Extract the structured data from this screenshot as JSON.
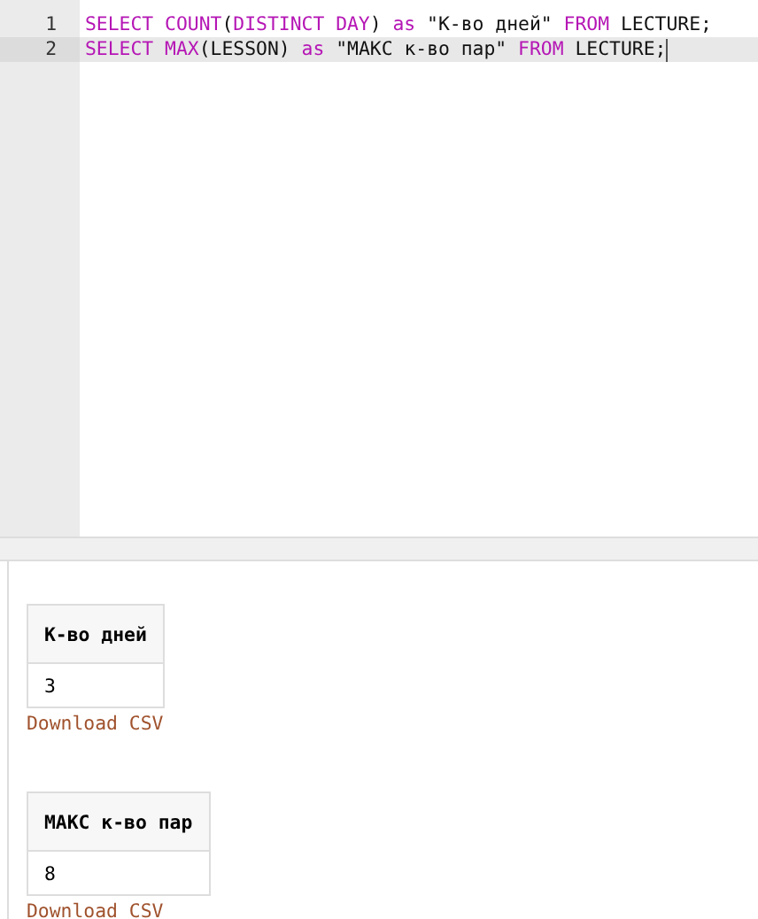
{
  "editor": {
    "lines": [
      {
        "number": "1",
        "selected": false,
        "tokens": [
          {
            "kind": "keyword",
            "text": "SELECT COUNT"
          },
          {
            "kind": "plain",
            "text": "("
          },
          {
            "kind": "keyword",
            "text": "DISTINCT DAY"
          },
          {
            "kind": "plain",
            "text": ") "
          },
          {
            "kind": "keyword",
            "text": "as"
          },
          {
            "kind": "plain",
            "text": " \"К-во дней\" "
          },
          {
            "kind": "keyword",
            "text": "FROM"
          },
          {
            "kind": "plain",
            "text": " LECTURE;"
          }
        ]
      },
      {
        "number": "2",
        "selected": true,
        "tokens": [
          {
            "kind": "keyword",
            "text": "SELECT MAX"
          },
          {
            "kind": "plain",
            "text": "(LESSON) "
          },
          {
            "kind": "keyword",
            "text": "as"
          },
          {
            "kind": "plain",
            "text": " \"МАКС к-во пар\" "
          },
          {
            "kind": "keyword",
            "text": "FROM"
          },
          {
            "kind": "plain",
            "text": " LECTURE;"
          }
        ]
      }
    ]
  },
  "results": [
    {
      "column": "К-во дней",
      "value": "3",
      "link": "Download CSV"
    },
    {
      "column": "МАКС к-во пар",
      "value": "8",
      "link": "Download CSV"
    }
  ]
}
